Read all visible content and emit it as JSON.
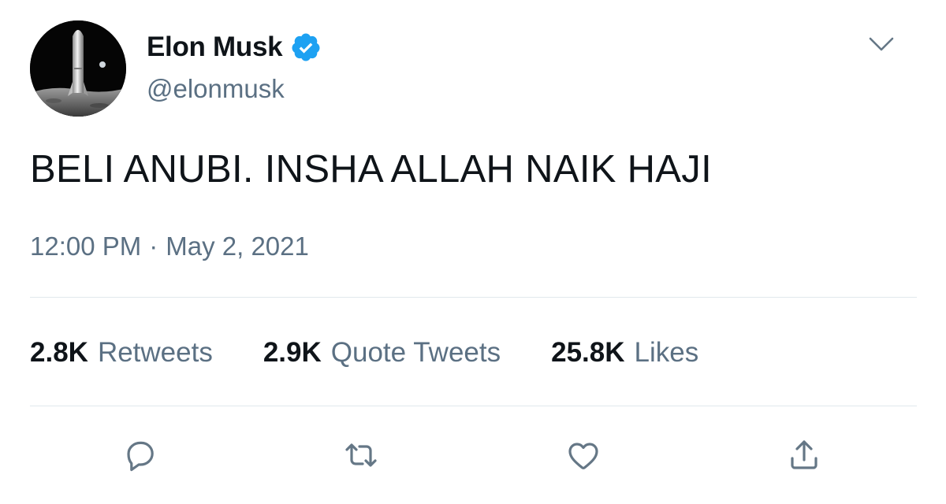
{
  "author": {
    "display_name": "Elon Musk",
    "handle": "@elonmusk",
    "verified": true,
    "avatar": "starship-on-moon-avatar"
  },
  "tweet": {
    "text": "BELI ANUBI. INSHA ALLAH NAIK HAJI",
    "time": "12:00 PM",
    "separator": "·",
    "date": "May 2, 2021"
  },
  "stats": {
    "retweets": {
      "count": "2.8K",
      "label": "Retweets"
    },
    "quote_tweets": {
      "count": "2.9K",
      "label": "Quote Tweets"
    },
    "likes": {
      "count": "25.8K",
      "label": "Likes"
    }
  },
  "actions": {
    "icons": [
      "reply-icon",
      "retweet-icon",
      "like-icon",
      "share-icon"
    ]
  },
  "colors": {
    "text_primary": "#0f1419",
    "text_secondary": "#5b7083",
    "verified_blue": "#1da1f2",
    "icon_gray": "#657786",
    "divider": "#e1e8ed"
  }
}
